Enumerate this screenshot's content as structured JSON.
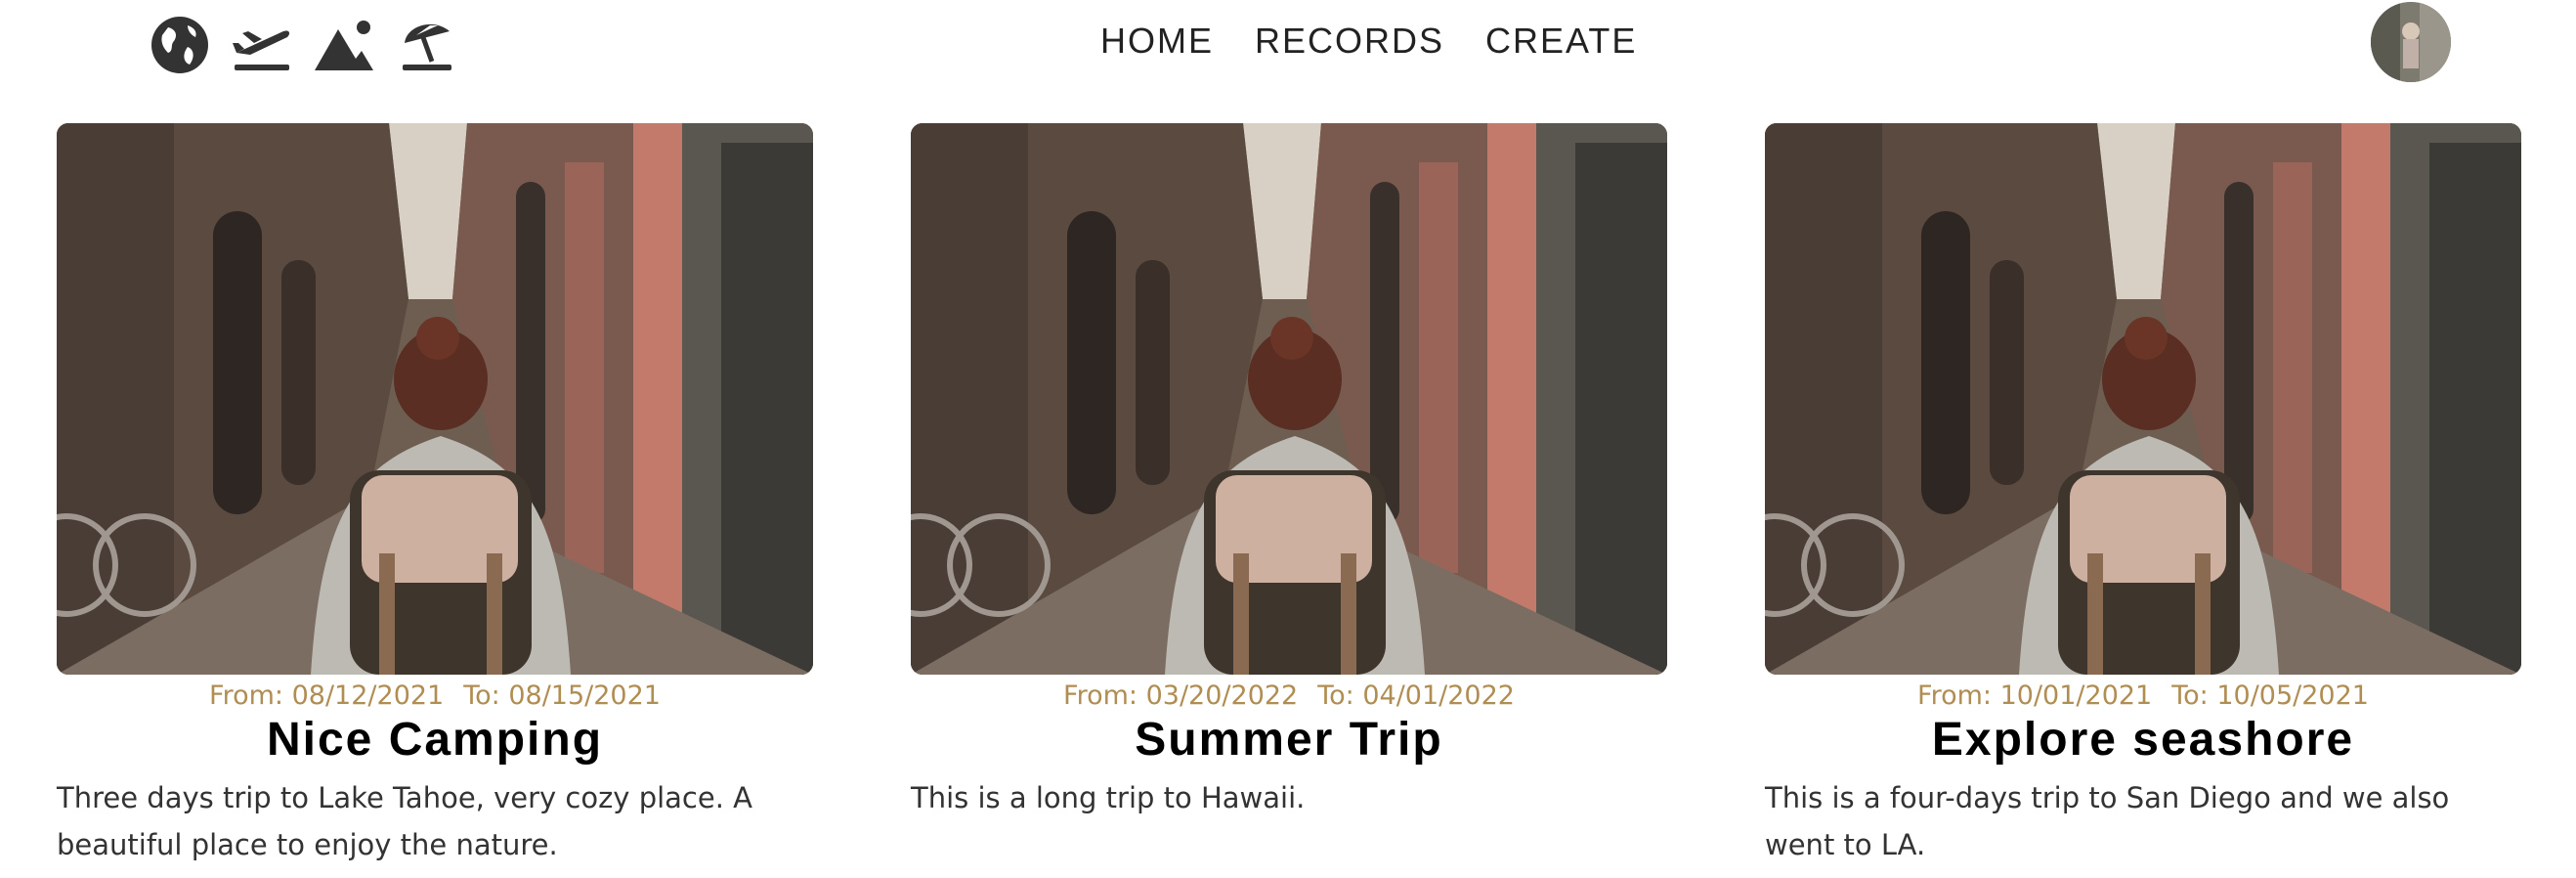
{
  "nav": {
    "icons": [
      "globe-icon",
      "plane-departure-icon",
      "mountain-icon",
      "beach-umbrella-icon"
    ],
    "links": [
      "HOME",
      "RECORDS",
      "CREATE"
    ]
  },
  "user": {
    "avatar": "user-avatar"
  },
  "cards": [
    {
      "from": "From: 08/12/2021",
      "to": "To: 08/15/2021",
      "title": "Nice Camping",
      "description": "Three days trip to Lake Tahoe, very cozy place. A beautiful place to enjoy the nature."
    },
    {
      "from": "From: 03/20/2022",
      "to": "To: 04/01/2022",
      "title": "Summer Trip",
      "description": "This is a long trip to Hawaii."
    },
    {
      "from": "From: 10/01/2021",
      "to": "To: 10/05/2021",
      "title": "Explore seashore",
      "description": "This is a four-days trip to San Diego and we also went to LA."
    }
  ],
  "colors": {
    "date": "#b08d52",
    "title": "#000000",
    "text": "#333333",
    "icon": "#333333"
  }
}
